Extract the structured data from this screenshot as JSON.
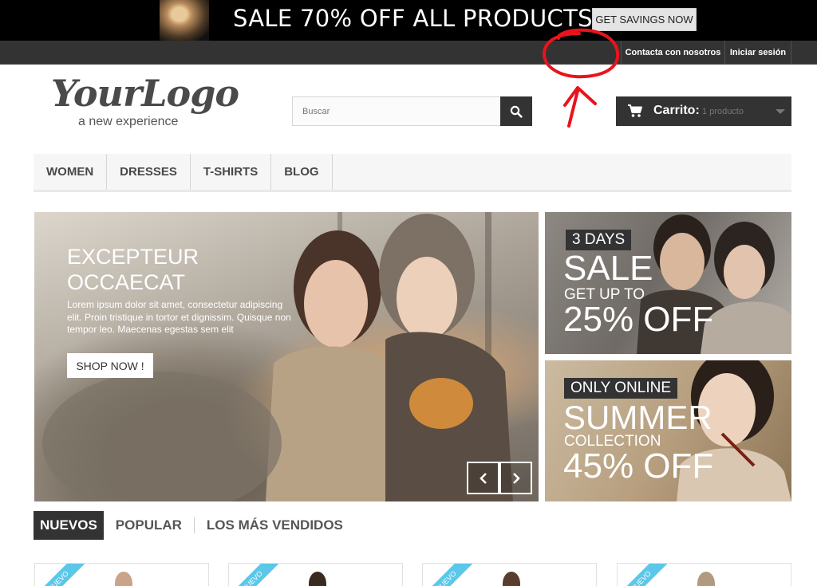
{
  "promo": {
    "headline": "SALE 70% OFF ALL PRODUCTS",
    "button_label": "GET SAVINGS NOW"
  },
  "top_nav": {
    "contact": "Contacta con nosotros",
    "login": "Iniciar sesión"
  },
  "logo": {
    "script": "YourLogo",
    "tagline": "a new experience"
  },
  "search": {
    "placeholder": "Buscar",
    "icon": "search-icon"
  },
  "cart": {
    "label": "Carrito:",
    "count": "1 producto",
    "icon": "cart-icon"
  },
  "menu": {
    "items": [
      "WOMEN",
      "DRESSES",
      "T-SHIRTS",
      "BLOG"
    ]
  },
  "slider": {
    "title_line1": "EXCEPTEUR",
    "title_line2": "OCCAECAT",
    "text": "Lorem ipsum dolor sit amet, consectetur adipiscing elit. Proin tristique in tortor et dignissim. Quisque non tempor leo. Maecenas egestas sem elit",
    "button": "SHOP NOW !"
  },
  "banners": [
    {
      "tag": "3 DAYS",
      "line1": "SALE",
      "line2": "GET UP TO",
      "line3": "25% OFF"
    },
    {
      "tag": "ONLY ONLINE",
      "line1": "SUMMER",
      "line2": "COLLECTION",
      "line3": "45% OFF"
    }
  ],
  "product_tabs": [
    "NUEVOS",
    "POPULAR",
    "LOS MÁS VENDIDOS"
  ],
  "product_badge": "NUEVO",
  "colors": {
    "dark": "#333333",
    "ribbon": "#5bc7e9",
    "annotation": "#e8141c"
  }
}
